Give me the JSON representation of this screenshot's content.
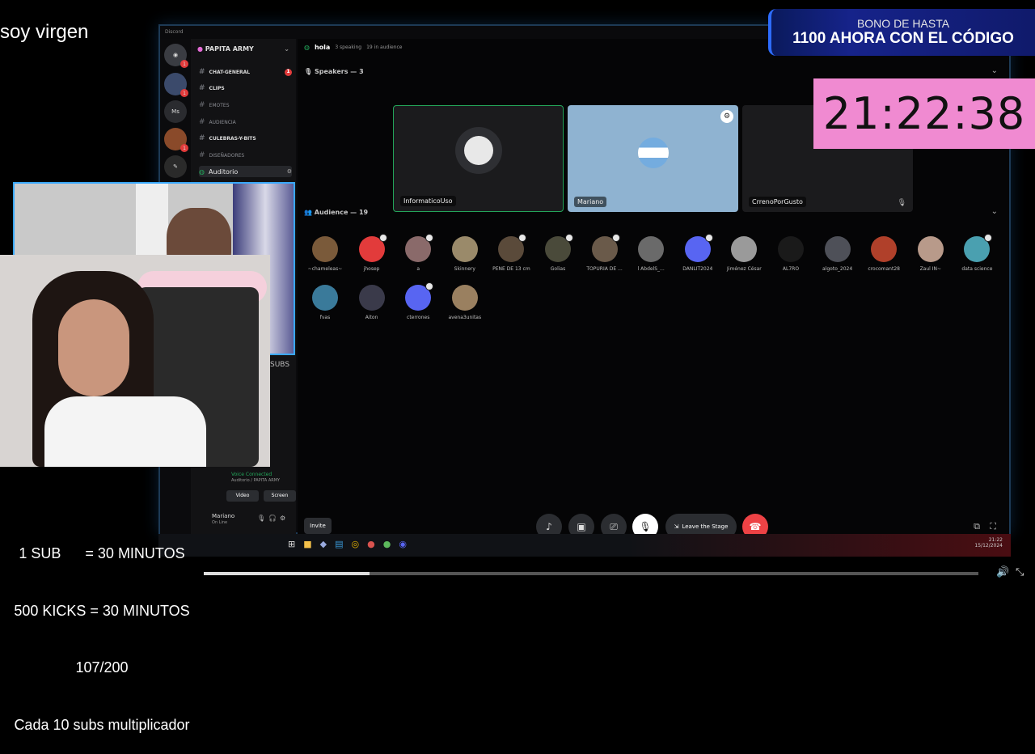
{
  "stream": {
    "top_left_caption": "soy virgen",
    "timer": "21:22:38",
    "promo": {
      "line1": "BONO DE HASTA",
      "line2": "1100 AHORA CON EL CÓDIGO"
    },
    "rules": [
      "1 SUB      = 30 MINUTOS",
      "500 KICKS = 30 MINUTOS",
      "107/200",
      "Cada 10 subs multiplicador"
    ],
    "subs_fragment": "SUBS"
  },
  "discord": {
    "window_title": "Discord",
    "server_name": "PAPITA ARMY",
    "channels": [
      {
        "label": "CHAT-GENERAL",
        "bold": true,
        "badge": "1"
      },
      {
        "label": "CLIPS",
        "bold": true
      },
      {
        "label": "EMOTES",
        "bold": false
      },
      {
        "label": "AUDIENCIA",
        "bold": false
      },
      {
        "label": "CULEBRAS-Y-BITS",
        "bold": true
      },
      {
        "label": "DISEÑADORES",
        "bold": false
      }
    ],
    "active_channel": "Auditorio",
    "voice": {
      "status": "Voice Connected",
      "sub": "Auditorio / PAPITA ARMY",
      "video_btn": "Video",
      "screen_btn": "Screen"
    },
    "user": {
      "name": "Mariano",
      "status": "On Line"
    },
    "stage": {
      "name": "hola",
      "speaking": "3 speaking",
      "audience_count": "19 in audience",
      "speakers_header": "Speakers — 3",
      "audience_header": "Audience — 19",
      "speakers": [
        {
          "name": "InformaticoUso",
          "bg": "#111214"
        },
        {
          "name": "Mariano",
          "bg": "#8fb3d1"
        },
        {
          "name": "CrrenoPorGusto",
          "bg": "#1b1b1d"
        }
      ],
      "audience": [
        {
          "name": "~chameleas~",
          "color": "#7a5a3a"
        },
        {
          "name": "jhosep",
          "color": "#e23b3b"
        },
        {
          "name": "a",
          "color": "#8a6a6a"
        },
        {
          "name": "Skinnery",
          "color": "#9a8a6a"
        },
        {
          "name": "PENE DE 13 cm",
          "color": "#5a4a3a"
        },
        {
          "name": "Golias",
          "color": "#4a4a3a"
        },
        {
          "name": "TOPURIA DE ...",
          "color": "#6a5a4a"
        },
        {
          "name": "l AbdelS_...",
          "color": "#6a6a6a"
        },
        {
          "name": "DANLIT2024",
          "color": "#5865f2"
        },
        {
          "name": "Jiménez César",
          "color": "#9a9a9a"
        },
        {
          "name": "AL7RO",
          "color": "#1a1a1a"
        },
        {
          "name": "algoto_2024",
          "color": "#4e5058"
        },
        {
          "name": "crocomant28",
          "color": "#b0402a"
        },
        {
          "name": "Zaul IN~",
          "color": "#b89a8a"
        },
        {
          "name": "data science",
          "color": "#4aa0b0"
        },
        {
          "name": "fvas",
          "color": "#3a7a9a"
        },
        {
          "name": "Aiton",
          "color": "#3a3a4a"
        },
        {
          "name": "cterrones",
          "color": "#5865f2"
        },
        {
          "name": "avena3unitas",
          "color": "#9a8060"
        }
      ],
      "invite_btn": "Invite",
      "leave_btn": "Leave the Stage"
    },
    "clock": {
      "time": "21:22",
      "date": "15/12/2024"
    }
  },
  "colors": {
    "accent": "#5865f2",
    "danger": "#ed4245",
    "online": "#23a55a",
    "timer_bg": "#f08ad1"
  }
}
